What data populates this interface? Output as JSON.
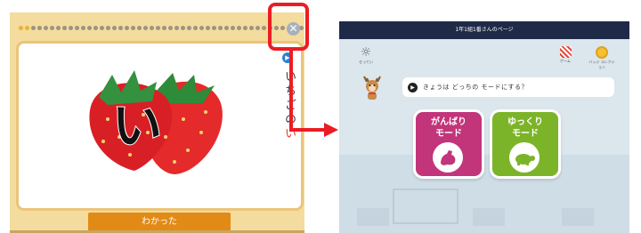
{
  "flashcard": {
    "kana": "い",
    "word_main": "いちごの",
    "word_accent": "い",
    "ok_button": "わかった",
    "close_symbol": "✕",
    "play_symbol": "▶",
    "progress_dots_total": 47,
    "progress_dots_done": 2
  },
  "app": {
    "window_title": "1年1組1番さんのページ",
    "settings_label": "せってい",
    "game_label": "ゲーム",
    "badge_label": "バッジ コレクション",
    "prompt": "きょうは どっちの モードにする？",
    "play_symbol": "▶",
    "modes": [
      {
        "label": "がんばり モード",
        "icon": "flexed-arm-icon",
        "color": "#c2357a"
      },
      {
        "label": "ゆっくり モード",
        "icon": "turtle-icon",
        "color": "#7cb429"
      }
    ]
  },
  "colors": {
    "highlight": "#ec1c24",
    "ok_button": "#e28a16",
    "titlebar": "#1e2a47"
  }
}
